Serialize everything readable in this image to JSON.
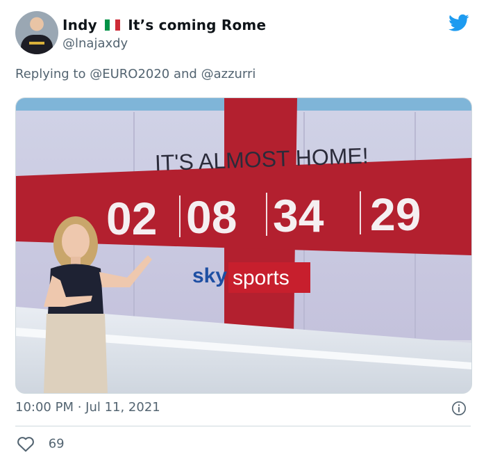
{
  "tweet": {
    "display_name": "Indy",
    "name_suffix": "It’s coming Rome",
    "handle": "@lnajaxdy",
    "reply_prefix": "Replying to",
    "reply_to_1": "@EURO2020",
    "reply_joiner": "and",
    "reply_to_2": "@azzurri",
    "timestamp": "10:00 PM · Jul 11, 2021",
    "like_count": "69"
  },
  "media": {
    "headline": "IT'S ALMOST HOME!",
    "countdown": [
      "02",
      "08",
      "34",
      "29"
    ],
    "brand_sky": "sky",
    "brand_sports": "sports"
  },
  "colors": {
    "twitter_blue": "#1d9bf0",
    "flag_green": "#009246",
    "flag_white": "#ffffff",
    "flag_red": "#ce2b37",
    "cross_red": "#b3202f",
    "muted_text": "#536471"
  },
  "icons": {
    "brand": "twitter-bird-icon",
    "info": "info-icon",
    "like": "heart-icon",
    "flag": "italy-flag-icon"
  }
}
